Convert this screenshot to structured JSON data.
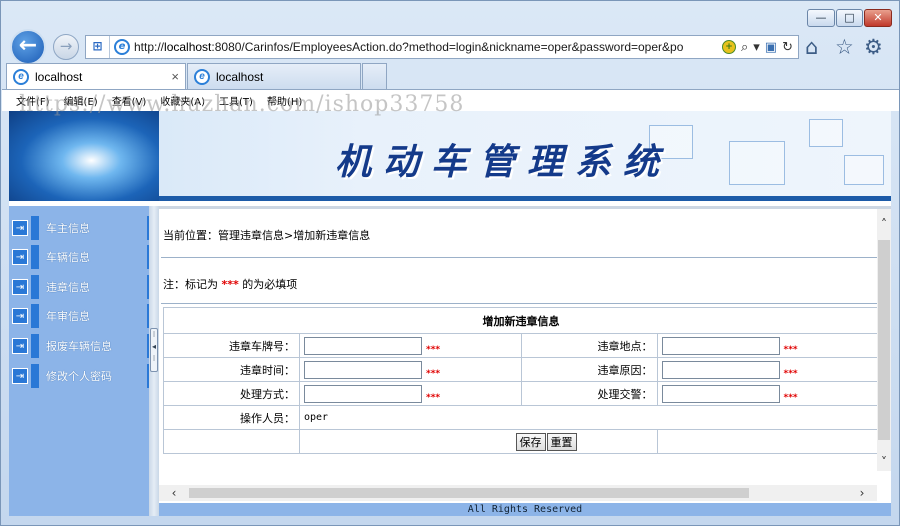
{
  "window": {
    "min_label": "—",
    "max_label": "□",
    "close_label": "✕"
  },
  "browser": {
    "url_host": "localhost",
    "url_prefix": "http://",
    "url_rest": ":8080/Carinfos/EmployeesAction.do?method=login&nickname=oper&password=oper&po",
    "search_glyph": "⌕",
    "dropdown_glyph": "▾",
    "refresh_glyph": "↻",
    "tabs": [
      {
        "label": "localhost",
        "close": "×"
      },
      {
        "label": "localhost"
      }
    ],
    "menu": [
      "文件(F)",
      "编辑(E)",
      "查看(V)",
      "收藏夹(A)",
      "工具(T)",
      "帮助(H)"
    ],
    "watermark": "https://www.huzhan.com/ishop33758"
  },
  "banner": {
    "title": "机动车管理系统"
  },
  "sidebar": {
    "items": [
      {
        "label": "车主信息"
      },
      {
        "label": "车辆信息"
      },
      {
        "label": "违章信息"
      },
      {
        "label": "年审信息"
      },
      {
        "label": "报废车辆信息"
      },
      {
        "label": "修改个人密码"
      }
    ]
  },
  "main": {
    "breadcrumb": "当前位置：管理违章信息>增加新违章信息",
    "note_prefix": "注：标记为",
    "note_marker": "***",
    "note_suffix": "的为必填项",
    "form": {
      "title": "增加新违章信息",
      "required_marker": "***",
      "fields": [
        {
          "label": "违章车牌号：",
          "value": ""
        },
        {
          "label": "违章地点：",
          "value": ""
        },
        {
          "label": "违章时间：",
          "value": ""
        },
        {
          "label": "违章原因：",
          "value": ""
        },
        {
          "label": "处理方式：",
          "value": ""
        },
        {
          "label": "处理交警：",
          "value": ""
        }
      ],
      "operator_label": "操作人员：",
      "operator_value": "oper",
      "save_label": "保存",
      "reset_label": "重置"
    },
    "footer": "All Rights Reserved"
  },
  "colors": {
    "accent": "#1c5ba8",
    "sidebar": "#8cb4e8",
    "required": "#e00000"
  }
}
